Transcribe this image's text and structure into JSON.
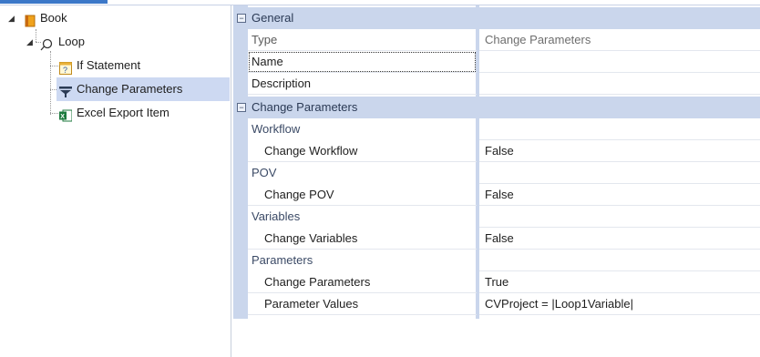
{
  "tree": {
    "root": {
      "label": "Book",
      "icon": "book-icon"
    },
    "loop": {
      "label": "Loop",
      "icon": "loop-icon"
    },
    "children": [
      {
        "label": "If Statement",
        "icon": "if-statement-icon"
      },
      {
        "label": "Change Parameters",
        "icon": "funnel-icon",
        "selected": true
      },
      {
        "label": "Excel Export Item",
        "icon": "excel-icon"
      }
    ]
  },
  "grid": {
    "general": {
      "title": "General",
      "type_name": "Type",
      "type_value": "Change Parameters",
      "name_name": "Name",
      "name_value": "",
      "description_name": "Description",
      "description_value": ""
    },
    "change_parameters": {
      "title": "Change Parameters",
      "workflow_header": "Workflow",
      "change_workflow_name": "Change Workflow",
      "change_workflow_value": "False",
      "pov_header": "POV",
      "change_pov_name": "Change POV",
      "change_pov_value": "False",
      "variables_header": "Variables",
      "change_variables_name": "Change Variables",
      "change_variables_value": "False",
      "parameters_header": "Parameters",
      "change_parameters_name": "Change Parameters",
      "change_parameters_value": "True",
      "parameter_values_name": "Parameter Values",
      "parameter_values_value": "CVProject = |Loop1Variable|"
    },
    "collapse_glyph": "⊟"
  },
  "colors": {
    "category_bg": "#cad6ec",
    "selection": "#cdd9f2",
    "accent": "#3c78c8"
  }
}
